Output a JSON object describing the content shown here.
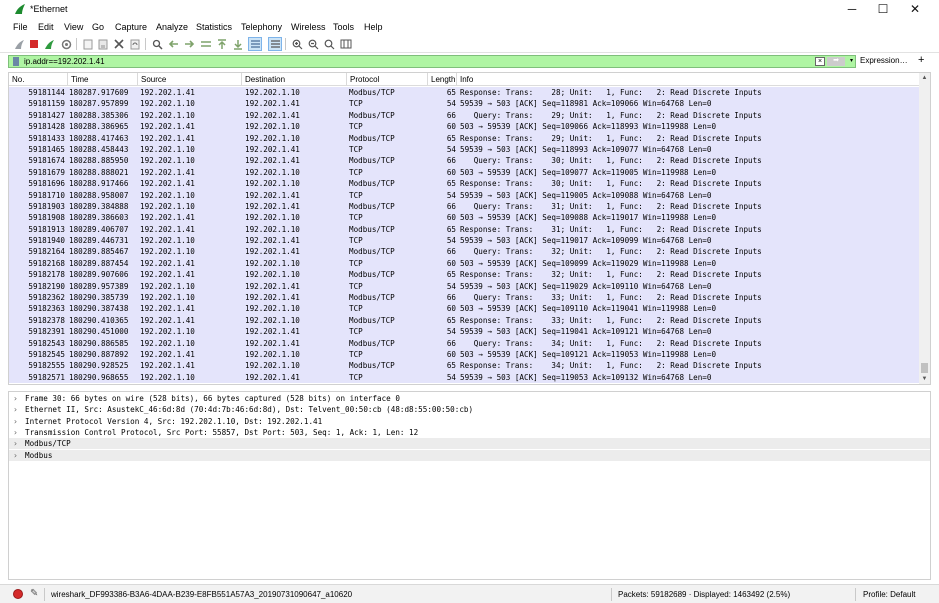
{
  "window": {
    "title": "*Ethernet",
    "minimize": "─",
    "maximize": "☐",
    "close": "✕"
  },
  "menu": [
    "File",
    "Edit",
    "View",
    "Go",
    "Capture",
    "Analyze",
    "Statistics",
    "Telephony",
    "Wireless",
    "Tools",
    "Help"
  ],
  "toolbar_icons": [
    "shark-fin-start-icon",
    "stop-capture-icon",
    "restart-capture-icon",
    "capture-options-icon",
    "open-file-icon",
    "save-file-icon",
    "close-file-icon",
    "reload-file-icon",
    "find-packet-icon",
    "go-back-icon",
    "go-forward-icon",
    "go-to-packet-icon",
    "first-packet-icon",
    "last-packet-icon",
    "autoscroll-icon",
    "colorize-icon",
    "zoom-in-icon",
    "zoom-out-icon",
    "normal-size-icon",
    "resize-columns-icon"
  ],
  "filter": {
    "value": "ip.addr==192.202.1.41",
    "expression_label": "Expression…",
    "add_label": "+"
  },
  "columns": [
    "No.",
    "Time",
    "Source",
    "Destination",
    "Protocol",
    "Length",
    "Info"
  ],
  "packets": [
    [
      "59181144",
      "180287.917609",
      "192.202.1.41",
      "192.202.1.10",
      "Modbus/TCP",
      "65",
      "Response: Trans:    28; Unit:   1, Func:   2: Read Discrete Inputs"
    ],
    [
      "59181159",
      "180287.957899",
      "192.202.1.10",
      "192.202.1.41",
      "TCP",
      "54",
      "59539 → 503 [ACK] Seq=118981 Ack=109066 Win=64768 Len=0"
    ],
    [
      "59181427",
      "180288.385306",
      "192.202.1.10",
      "192.202.1.41",
      "Modbus/TCP",
      "66",
      "   Query: Trans:    29; Unit:   1, Func:   2: Read Discrete Inputs"
    ],
    [
      "59181428",
      "180288.386965",
      "192.202.1.41",
      "192.202.1.10",
      "TCP",
      "60",
      "503 → 59539 [ACK] Seq=109066 Ack=118993 Win=119988 Len=0"
    ],
    [
      "59181433",
      "180288.417463",
      "192.202.1.41",
      "192.202.1.10",
      "Modbus/TCP",
      "65",
      "Response: Trans:    29; Unit:   1, Func:   2: Read Discrete Inputs"
    ],
    [
      "59181465",
      "180288.458443",
      "192.202.1.10",
      "192.202.1.41",
      "TCP",
      "54",
      "59539 → 503 [ACK] Seq=118993 Ack=109077 Win=64768 Len=0"
    ],
    [
      "59181674",
      "180288.885950",
      "192.202.1.10",
      "192.202.1.41",
      "Modbus/TCP",
      "66",
      "   Query: Trans:    30; Unit:   1, Func:   2: Read Discrete Inputs"
    ],
    [
      "59181679",
      "180288.888021",
      "192.202.1.41",
      "192.202.1.10",
      "TCP",
      "60",
      "503 → 59539 [ACK] Seq=109077 Ack=119005 Win=119988 Len=0"
    ],
    [
      "59181696",
      "180288.917466",
      "192.202.1.41",
      "192.202.1.10",
      "Modbus/TCP",
      "65",
      "Response: Trans:    30; Unit:   1, Func:   2: Read Discrete Inputs"
    ],
    [
      "59181710",
      "180288.958007",
      "192.202.1.10",
      "192.202.1.41",
      "TCP",
      "54",
      "59539 → 503 [ACK] Seq=119005 Ack=109088 Win=64768 Len=0"
    ],
    [
      "59181903",
      "180289.384888",
      "192.202.1.10",
      "192.202.1.41",
      "Modbus/TCP",
      "66",
      "   Query: Trans:    31; Unit:   1, Func:   2: Read Discrete Inputs"
    ],
    [
      "59181908",
      "180289.386603",
      "192.202.1.41",
      "192.202.1.10",
      "TCP",
      "60",
      "503 → 59539 [ACK] Seq=109088 Ack=119017 Win=119988 Len=0"
    ],
    [
      "59181913",
      "180289.406707",
      "192.202.1.41",
      "192.202.1.10",
      "Modbus/TCP",
      "65",
      "Response: Trans:    31; Unit:   1, Func:   2: Read Discrete Inputs"
    ],
    [
      "59181940",
      "180289.446731",
      "192.202.1.10",
      "192.202.1.41",
      "TCP",
      "54",
      "59539 → 503 [ACK] Seq=119017 Ack=109099 Win=64768 Len=0"
    ],
    [
      "59182164",
      "180289.885467",
      "192.202.1.10",
      "192.202.1.41",
      "Modbus/TCP",
      "66",
      "   Query: Trans:    32; Unit:   1, Func:   2: Read Discrete Inputs"
    ],
    [
      "59182168",
      "180289.887454",
      "192.202.1.41",
      "192.202.1.10",
      "TCP",
      "60",
      "503 → 59539 [ACK] Seq=109099 Ack=119029 Win=119988 Len=0"
    ],
    [
      "59182178",
      "180289.907606",
      "192.202.1.41",
      "192.202.1.10",
      "Modbus/TCP",
      "65",
      "Response: Trans:    32; Unit:   1, Func:   2: Read Discrete Inputs"
    ],
    [
      "59182190",
      "180289.957389",
      "192.202.1.10",
      "192.202.1.41",
      "TCP",
      "54",
      "59539 → 503 [ACK] Seq=119029 Ack=109110 Win=64768 Len=0"
    ],
    [
      "59182362",
      "180290.385739",
      "192.202.1.10",
      "192.202.1.41",
      "Modbus/TCP",
      "66",
      "   Query: Trans:    33; Unit:   1, Func:   2: Read Discrete Inputs"
    ],
    [
      "59182363",
      "180290.387438",
      "192.202.1.41",
      "192.202.1.10",
      "TCP",
      "60",
      "503 → 59539 [ACK] Seq=109110 Ack=119041 Win=119988 Len=0"
    ],
    [
      "59182378",
      "180290.410365",
      "192.202.1.41",
      "192.202.1.10",
      "Modbus/TCP",
      "65",
      "Response: Trans:    33; Unit:   1, Func:   2: Read Discrete Inputs"
    ],
    [
      "59182391",
      "180290.451000",
      "192.202.1.10",
      "192.202.1.41",
      "TCP",
      "54",
      "59539 → 503 [ACK] Seq=119041 Ack=109121 Win=64768 Len=0"
    ],
    [
      "59182543",
      "180290.886585",
      "192.202.1.10",
      "192.202.1.41",
      "Modbus/TCP",
      "66",
      "   Query: Trans:    34; Unit:   1, Func:   2: Read Discrete Inputs"
    ],
    [
      "59182545",
      "180290.887892",
      "192.202.1.41",
      "192.202.1.10",
      "TCP",
      "60",
      "503 → 59539 [ACK] Seq=109121 Ack=119053 Win=119988 Len=0"
    ],
    [
      "59182555",
      "180290.928525",
      "192.202.1.41",
      "192.202.1.10",
      "Modbus/TCP",
      "65",
      "Response: Trans:    34; Unit:   1, Func:   2: Read Discrete Inputs"
    ],
    [
      "59182571",
      "180290.968655",
      "192.202.1.10",
      "192.202.1.41",
      "TCP",
      "54",
      "59539 → 503 [ACK] Seq=119053 Ack=109132 Win=64768 Len=0"
    ]
  ],
  "details": [
    "Frame 30: 66 bytes on wire (528 bits), 66 bytes captured (528 bits) on interface 0",
    "Ethernet II, Src: AsustekC_46:6d:8d (70:4d:7b:46:6d:8d), Dst: Telvent_00:50:cb (48:d8:55:00:50:cb)",
    "Internet Protocol Version 4, Src: 192.202.1.10, Dst: 192.202.1.41",
    "Transmission Control Protocol, Src Port: 55857, Dst Port: 503, Seq: 1, Ack: 1, Len: 12",
    "Modbus/TCP",
    "Modbus"
  ],
  "detail_arrow": "›",
  "status": {
    "file": "wireshark_DF993386-B3A6-4DAA-B239-E8FB551A57A3_20190731090647_a10620",
    "packets": "Packets: 59182689 · Displayed: 1463492 (2.5%)",
    "profile": "Profile: Default",
    "edit_glyph": "✎"
  },
  "colors": {
    "row_background": "#e4e4fb",
    "filter_valid": "#aff5a3",
    "capture_stopped": "#d42a2a"
  }
}
